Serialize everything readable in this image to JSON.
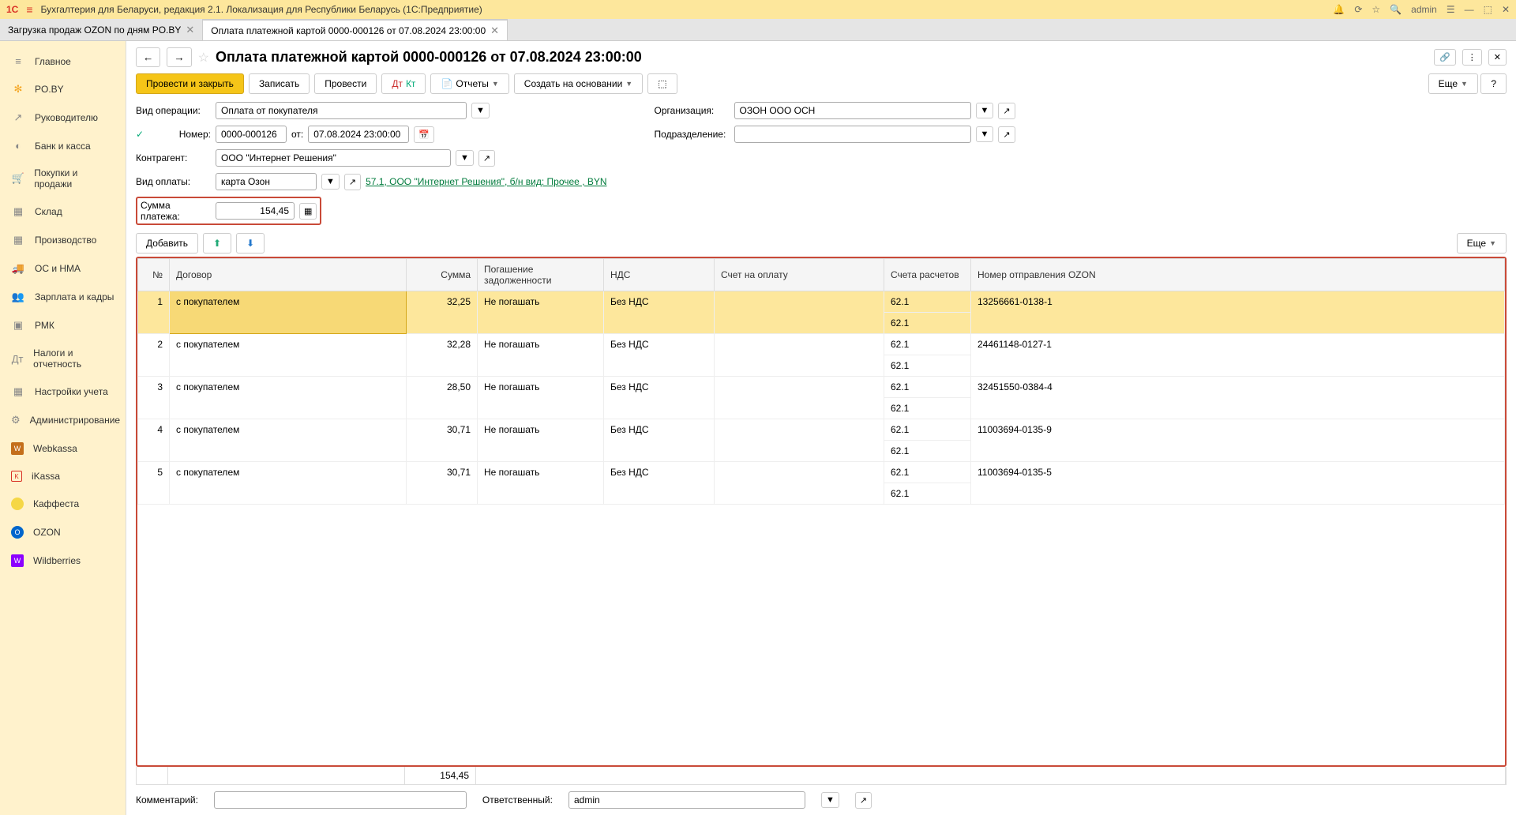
{
  "titlebar": {
    "logo": "1C",
    "title": "Бухгалтерия для Беларуси, редакция 2.1. Локализация для Республики Беларусь   (1С:Предприятие)",
    "user": "admin"
  },
  "tabs": [
    {
      "label": "Загрузка продаж OZON по дням PO.BY",
      "active": false
    },
    {
      "label": "Оплата платежной картой 0000-000126 от 07.08.2024 23:00:00",
      "active": true
    }
  ],
  "sidebar": [
    {
      "icon": "≡",
      "label": "Главное"
    },
    {
      "icon": "✻",
      "cls": "orange-star",
      "label": "PO.BY"
    },
    {
      "icon": "↗",
      "label": "Руководителю"
    },
    {
      "icon": "◐",
      "label": "Банк и касса"
    },
    {
      "icon": "🛒",
      "label": "Покупки и продажи"
    },
    {
      "icon": "▦",
      "label": "Склад"
    },
    {
      "icon": "▦",
      "label": "Производство"
    },
    {
      "icon": "🚚",
      "label": "ОС и НМА"
    },
    {
      "icon": "👥",
      "label": "Зарплата и кадры"
    },
    {
      "icon": "▣",
      "label": "РМК"
    },
    {
      "icon": "Дт",
      "label": "Налоги и отчетность"
    },
    {
      "icon": "▦",
      "label": "Настройки учета"
    },
    {
      "icon": "⚙",
      "label": "Администрирование"
    },
    {
      "icon": "W",
      "cls": "wc",
      "label": "Webkassa"
    },
    {
      "icon": "K",
      "cls": "ik",
      "label": "iKassa"
    },
    {
      "icon": "",
      "cls": "yellow-circle",
      "label": "Каффеста"
    },
    {
      "icon": "O",
      "cls": "ozon",
      "label": "OZON"
    },
    {
      "icon": "W",
      "cls": "wb",
      "label": "Wildberries"
    }
  ],
  "page": {
    "title": "Оплата платежной картой 0000-000126 от 07.08.2024 23:00:00"
  },
  "toolbar": {
    "post_close": "Провести и закрыть",
    "record": "Записать",
    "post": "Провести",
    "reports": "Отчеты",
    "create_based": "Создать на основании",
    "more": "Еще"
  },
  "form": {
    "operation_type_label": "Вид операции:",
    "operation_type": "Оплата от покупателя",
    "number_label": "Номер:",
    "number": "0000-000126",
    "date_label": "от:",
    "date": "07.08.2024 23:00:00",
    "contractor_label": "Контрагент:",
    "contractor": "ООО \"Интернет Решения\"",
    "payment_type_label": "Вид оплаты:",
    "payment_type": "карта Озон",
    "payment_link": "57.1, ООО \"Интернет Решения\", б/н вид: Прочее , BYN",
    "amount_label": "Сумма платежа:",
    "amount": "154,45",
    "org_label": "Организация:",
    "org": "ОЗОН ООО ОСН",
    "dept_label": "Подразделение:",
    "dept": ""
  },
  "table_controls": {
    "add": "Добавить",
    "more": "Еще"
  },
  "table": {
    "headers": {
      "num": "№",
      "contract": "Договор",
      "sum": "Сумма",
      "repay": "Погашение задолженности",
      "vat": "НДС",
      "invoice": "Счет на оплату",
      "accounts": "Счета расчетов",
      "ozon_num": "Номер отправления OZON"
    },
    "rows": [
      {
        "num": "1",
        "contract": "с покупателем",
        "sum": "32,25",
        "repay": "Не погашать",
        "vat": "Без НДС",
        "invoice": "",
        "acc1": "62.1",
        "acc2": "62.1",
        "ozon": "13256661-0138-1",
        "selected": true
      },
      {
        "num": "2",
        "contract": "с покупателем",
        "sum": "32,28",
        "repay": "Не погашать",
        "vat": "Без НДС",
        "invoice": "",
        "acc1": "62.1",
        "acc2": "62.1",
        "ozon": "24461148-0127-1"
      },
      {
        "num": "3",
        "contract": "с покупателем",
        "sum": "28,50",
        "repay": "Не погашать",
        "vat": "Без НДС",
        "invoice": "",
        "acc1": "62.1",
        "acc2": "62.1",
        "ozon": "32451550-0384-4"
      },
      {
        "num": "4",
        "contract": "с покупателем",
        "sum": "30,71",
        "repay": "Не погашать",
        "vat": "Без НДС",
        "invoice": "",
        "acc1": "62.1",
        "acc2": "62.1",
        "ozon": "11003694-0135-9"
      },
      {
        "num": "5",
        "contract": "с покупателем",
        "sum": "30,71",
        "repay": "Не погашать",
        "vat": "Без НДС",
        "invoice": "",
        "acc1": "62.1",
        "acc2": "62.1",
        "ozon": "11003694-0135-5"
      }
    ],
    "summary_sum": "154,45"
  },
  "bottom": {
    "comment_label": "Комментарий:",
    "comment": "",
    "responsible_label": "Ответственный:",
    "responsible": "admin"
  }
}
